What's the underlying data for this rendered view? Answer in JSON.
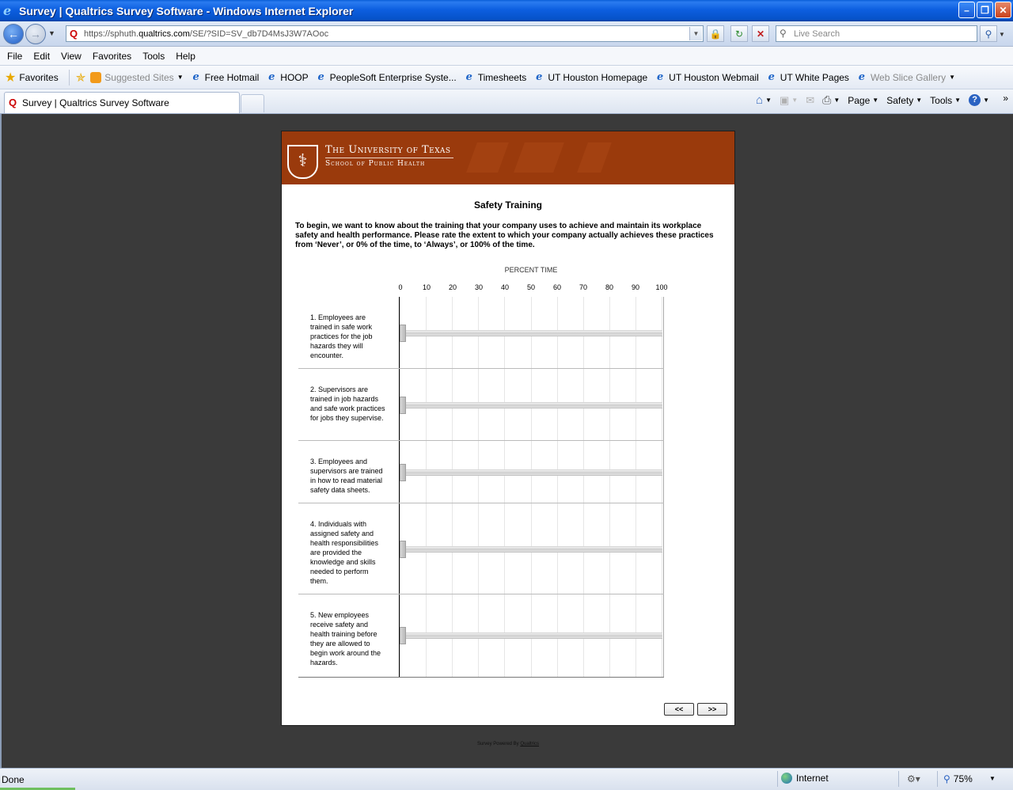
{
  "window": {
    "title": "Survey | Qualtrics Survey Software - Windows Internet Explorer"
  },
  "address_bar": {
    "url_prefix": "https://sphuth.",
    "url_domain": "qualtrics.com",
    "url_path": "/SE/?SID=SV_db7D4MsJ3W7AOoc",
    "search_placeholder": "Live Search"
  },
  "menu": [
    "File",
    "Edit",
    "View",
    "Favorites",
    "Tools",
    "Help"
  ],
  "favorites_bar": {
    "favorites_label": "Favorites",
    "items": [
      {
        "label": "Suggested Sites",
        "muted": true,
        "dropdown": true
      },
      {
        "label": "Free Hotmail"
      },
      {
        "label": "HOOP"
      },
      {
        "label": "PeopleSoft Enterprise Syste..."
      },
      {
        "label": "Timesheets"
      },
      {
        "label": "UT Houston Homepage"
      },
      {
        "label": "UT Houston Webmail"
      },
      {
        "label": "UT White Pages"
      },
      {
        "label": "Web Slice Gallery",
        "muted": true,
        "dropdown": true
      }
    ]
  },
  "tabs": {
    "active_label": "Survey | Qualtrics Survey Software"
  },
  "command_bar": {
    "page": "Page",
    "safety": "Safety",
    "tools": "Tools"
  },
  "survey": {
    "banner": {
      "university": "The University of Texas",
      "school": "School of Public Health"
    },
    "question_title": "Safety Training",
    "intro": "To begin, we want to know about the training that your company uses to achieve and maintain its workplace safety and health performance. Please rate the extent to which your company actually achieves these practices from ‘Never’, or 0% of the time, to ‘Always’, or 100% of the time.",
    "scale_label": "PERCENT TIME",
    "ticks": [
      "0",
      "10",
      "20",
      "30",
      "40",
      "50",
      "60",
      "70",
      "80",
      "90",
      "100"
    ],
    "items": [
      {
        "label": "1. Employees are trained in safe work practices for the job hazards they will encounter.",
        "value": 0
      },
      {
        "label": "2. Supervisors are trained in job hazards and safe work practices for jobs they supervise.",
        "value": 0
      },
      {
        "label": "3. Employees and supervisors are trained in how to read material safety data sheets.",
        "value": 0
      },
      {
        "label": "4. Individuals with assigned safety and health responsibilities are provided the knowledge and skills needed to perform them.",
        "value": 0
      },
      {
        "label": "5. New employees receive safety and health training before they are allowed to begin work around the hazards.",
        "value": 0
      }
    ],
    "back_button": "<<",
    "next_button": ">>"
  },
  "footer": {
    "powered_by": "Survey Powered By",
    "qualtrics_link": "Qualtrics"
  },
  "status_bar": {
    "status": "Done",
    "zone": "Internet",
    "zoom": "75%"
  }
}
